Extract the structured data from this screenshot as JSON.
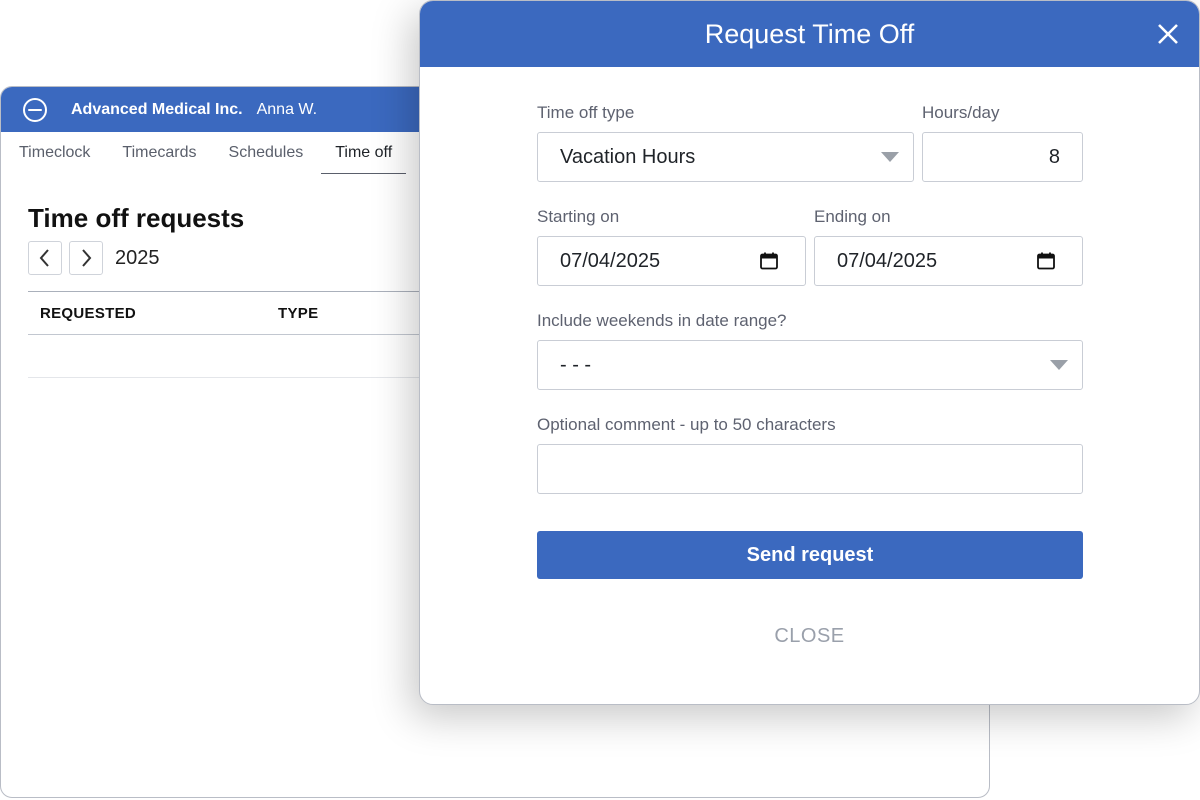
{
  "app": {
    "company": "Advanced Medical Inc.",
    "user": "Anna W.",
    "tabs": [
      "Timeclock",
      "Timecards",
      "Schedules",
      "Time off"
    ],
    "active_tab": "Time off",
    "page_title": "Time off requests",
    "year": "2025",
    "table": {
      "columns": [
        "REQUESTED",
        "TYPE"
      ],
      "rows": []
    }
  },
  "modal": {
    "title": "Request Time Off",
    "time_off_type": {
      "label": "Time off type",
      "value": "Vacation Hours"
    },
    "hours_per_day": {
      "label": "Hours/day",
      "value": "8"
    },
    "starting_on": {
      "label": "Starting on",
      "value": "07/04/2025"
    },
    "ending_on": {
      "label": "Ending on",
      "value": "07/04/2025"
    },
    "include_weekends": {
      "label": "Include weekends in date range?",
      "value": "- - -"
    },
    "comment": {
      "label": "Optional comment - up to 50 characters",
      "value": ""
    },
    "send_label": "Send request",
    "close_label": "CLOSE"
  },
  "colors": {
    "brand": "#3b69bf",
    "muted_text": "#5e6270",
    "close_link": "#9aa0ab"
  },
  "icons": {
    "logo": "company-logo-icon",
    "prev": "chevron-left-icon",
    "next": "chevron-right-icon",
    "close": "close-icon",
    "calendar": "calendar-icon",
    "dropdown": "caret-down-icon"
  }
}
